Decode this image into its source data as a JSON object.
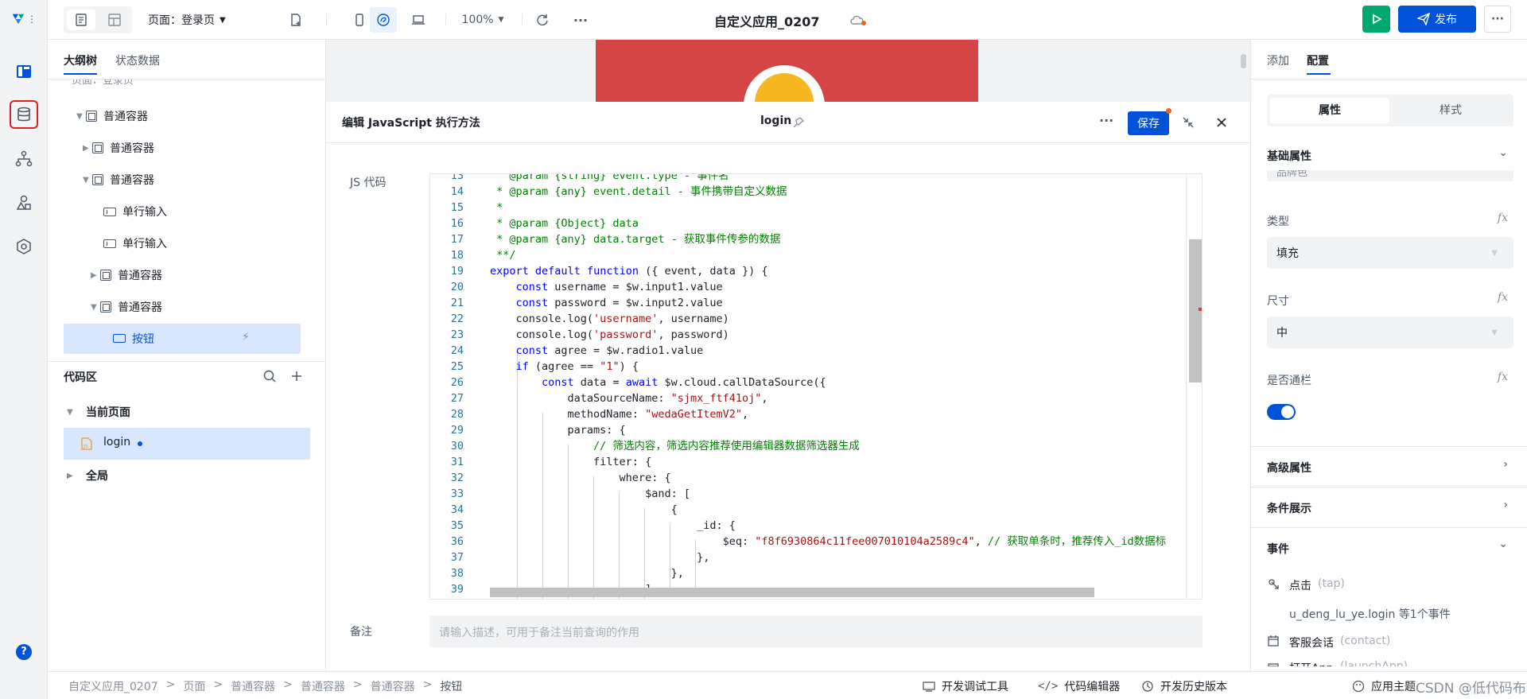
{
  "topbar": {
    "page_label": "页面：登录页",
    "zoom": "100%",
    "app_title": "自定义应用_0207",
    "publish_label": "发布"
  },
  "left_panel": {
    "tabs": [
      "大纲树",
      "状态数据"
    ],
    "tree_partial": "页面：登录页",
    "tree": [
      {
        "label": "普通容器"
      },
      {
        "label": "普通容器"
      },
      {
        "label": "普通容器"
      },
      {
        "label": "单行输入"
      },
      {
        "label": "单行输入"
      },
      {
        "label": "普通容器"
      },
      {
        "label": "普通容器"
      },
      {
        "label": "按钮"
      }
    ],
    "code_area_title": "代码区",
    "current_page_label": "当前页面",
    "code_item": "login",
    "global_label": "全局"
  },
  "dialog": {
    "title": "编辑 JavaScript 执行方法",
    "method_name": "login",
    "save_label": "保存",
    "js_label": "JS 代码",
    "remark_label": "备注",
    "remark_placeholder": "请输入描述，可用于备注当前查询的作用"
  },
  "code_lines": [
    {
      "n": "13",
      "t": "   @param {string} event.type - 事件名"
    },
    {
      "n": "14",
      "t": " * @param {any} event.detail - 事件携带自定义数据"
    },
    {
      "n": "15",
      "t": " *"
    },
    {
      "n": "16",
      "t": " * @param {Object} data"
    },
    {
      "n": "17",
      "t": " * @param {any} data.target - 获取事件传参的数据"
    },
    {
      "n": "18",
      "t": " **/"
    },
    {
      "n": "19",
      "t": "export default function ({ event, data }) {"
    },
    {
      "n": "20",
      "t": "    const username = $w.input1.value"
    },
    {
      "n": "21",
      "t": "    const password = $w.input2.value"
    },
    {
      "n": "22",
      "t": "    console.log('username', username)"
    },
    {
      "n": "23",
      "t": "    console.log('password', password)"
    },
    {
      "n": "24",
      "t": "    const agree = $w.radio1.value"
    },
    {
      "n": "25",
      "t": "    if (agree == \"1\") {"
    },
    {
      "n": "26",
      "t": "        const data = await $w.cloud.callDataSource({"
    },
    {
      "n": "27",
      "t": "            dataSourceName: \"sjmx_ftf41oj\","
    },
    {
      "n": "28",
      "t": "            methodName: \"wedaGetItemV2\","
    },
    {
      "n": "29",
      "t": "            params: {"
    },
    {
      "n": "30",
      "t": "                // 筛选内容，筛选内容推荐使用编辑器数据筛选器生成"
    },
    {
      "n": "31",
      "t": "                filter: {"
    },
    {
      "n": "32",
      "t": "                    where: {"
    },
    {
      "n": "33",
      "t": "                        $and: ["
    },
    {
      "n": "34",
      "t": "                            {"
    },
    {
      "n": "35",
      "t": "                                _id: {"
    },
    {
      "n": "36",
      "t": "                                    $eq: \"f8f6930864c11fee007010104a2589c4\", // 获取单条时，推荐传入_id数据标"
    },
    {
      "n": "37",
      "t": "                                },"
    },
    {
      "n": "38",
      "t": "                            },"
    },
    {
      "n": "39",
      "t": "                        ],"
    }
  ],
  "right_panel": {
    "tabs": [
      "添加",
      "配置"
    ],
    "segment": [
      "属性",
      "样式"
    ],
    "basic_title": "基础属性",
    "partial_value": "品牌色",
    "type_label": "类型",
    "type_value": "填充",
    "size_label": "尺寸",
    "size_value": "中",
    "block_label": "是否通栏",
    "fx": "fx",
    "advanced_title": "高级属性",
    "condition_title": "条件展示",
    "events_title": "事件",
    "event_click": "点击",
    "event_click_code": "(tap)",
    "event_click_detail": "u_deng_lu_ye.login 等1个事件",
    "event_contact": "客服会话",
    "event_contact_code": "(contact)",
    "event_launch": "打开App",
    "event_launch_code": "(launchApp)"
  },
  "footer": {
    "breadcrumb": [
      "自定义应用_0207",
      "页面",
      "普通容器",
      "普通容器",
      "普通容器",
      "按钮"
    ],
    "sep": ">",
    "tools": [
      "开发调试工具",
      "代码编辑器",
      "开发历史版本",
      "应用主题"
    ],
    "watermark": "CSDN @低代码布道师"
  },
  "colors": {
    "primary": "#0052d9",
    "run": "#00a870",
    "banner": "#d64545",
    "highlight": "#d13c3c"
  }
}
